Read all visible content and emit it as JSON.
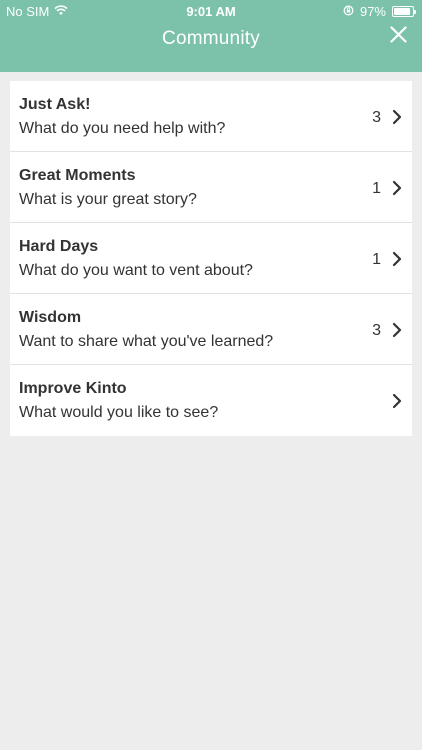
{
  "status_bar": {
    "carrier": "No SIM",
    "time": "9:01 AM",
    "battery": "97%",
    "battery_level": 0.97
  },
  "header": {
    "title": "Community",
    "close_icon": "close-icon"
  },
  "categories": [
    {
      "name": "Just Ask!",
      "subtitle": "What do you need help with?",
      "count": "3"
    },
    {
      "name": "Great Moments",
      "subtitle": "What is your great story?",
      "count": "1"
    },
    {
      "name": "Hard Days",
      "subtitle": "What do you want to vent about?",
      "count": "1"
    },
    {
      "name": "Wisdom",
      "subtitle": "Want to share what you've learned?",
      "count": "3"
    },
    {
      "name": "Improve Kinto",
      "subtitle": "What would you like to see?",
      "count": ""
    }
  ],
  "colors": {
    "header": "#7cc2aa",
    "background": "#ededed",
    "card": "#ffffff",
    "text": "#333333"
  }
}
